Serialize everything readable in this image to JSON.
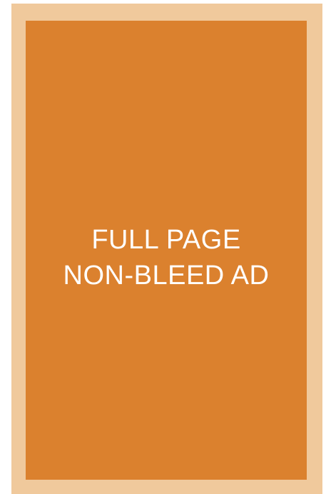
{
  "ad": {
    "line1": "FULL PAGE",
    "line2": "NON-BLEED AD"
  },
  "colors": {
    "page_border": "#f0c99c",
    "ad_fill": "#db812e",
    "text": "#ffffff"
  }
}
